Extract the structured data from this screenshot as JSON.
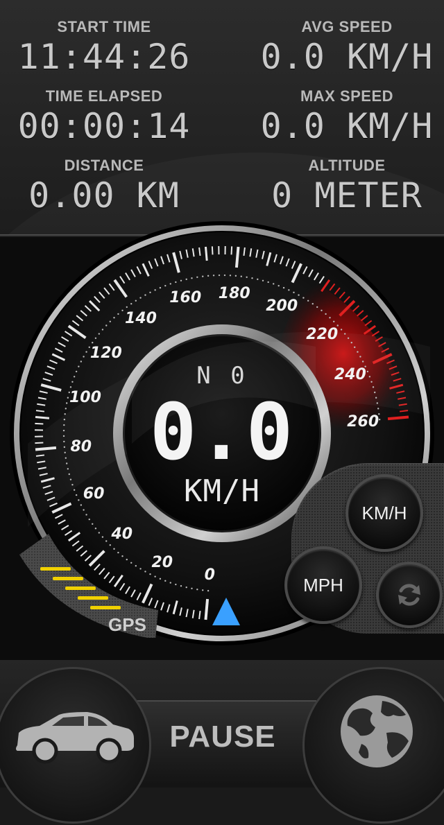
{
  "stats": {
    "start_time": {
      "label": "START TIME",
      "value": "11:44:26"
    },
    "avg_speed": {
      "label": "AVG SPEED",
      "value": "0.0 KM/H"
    },
    "time_elapsed": {
      "label": "TIME ELAPSED",
      "value": "00:00:14"
    },
    "max_speed": {
      "label": "MAX SPEED",
      "value": "0.0 KM/H"
    },
    "distance": {
      "label": "DISTANCE",
      "value": "0.00 KM"
    },
    "altitude": {
      "label": "ALTITUDE",
      "value": "0 METER"
    }
  },
  "gauge": {
    "scale_labels": [
      "0",
      "20",
      "40",
      "60",
      "80",
      "100",
      "120",
      "140",
      "160",
      "180",
      "200",
      "220",
      "240",
      "260"
    ],
    "direction": "N 0",
    "speed": "0.0",
    "unit": "KM/H",
    "redline_color": "#d0141a",
    "needle_color": "#3aa0ff"
  },
  "controls": {
    "kmh_label": "KM/H",
    "mph_label": "MPH",
    "refresh_icon": "refresh-icon"
  },
  "gps": {
    "label": "GPS",
    "bar_color": "#f0d000"
  },
  "bottom": {
    "pause_label": "PAUSE",
    "car_icon": "car-icon",
    "globe_icon": "globe-icon"
  }
}
